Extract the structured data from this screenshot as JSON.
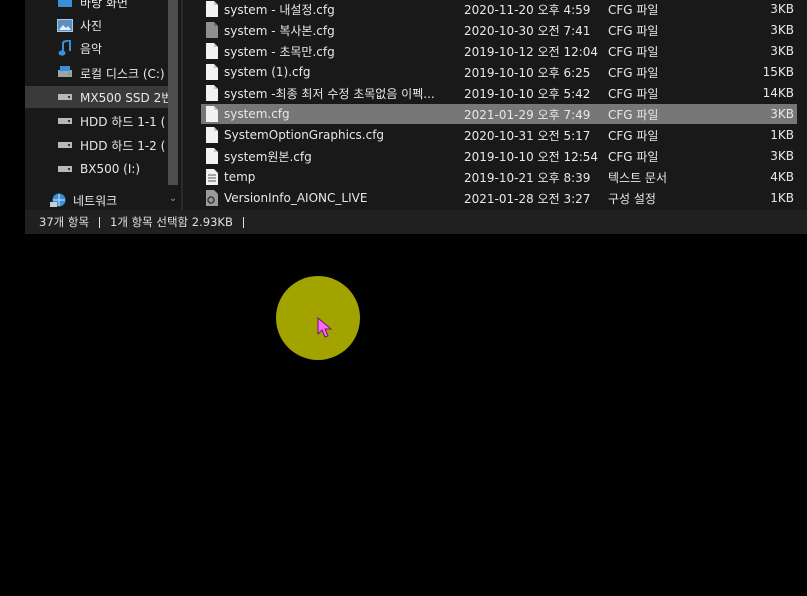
{
  "nav": {
    "items": [
      {
        "label": "바탕 화면",
        "icon": "desktop-icon"
      },
      {
        "label": "사진",
        "icon": "pictures-icon"
      },
      {
        "label": "음악",
        "icon": "music-icon"
      },
      {
        "label": "로컬 디스크 (C:)",
        "icon": "local-disk-icon"
      },
      {
        "label": "MX500 SSD 2번",
        "icon": "drive-icon",
        "selected": true
      },
      {
        "label": "HDD 하드 1-1 (",
        "icon": "drive-icon"
      },
      {
        "label": "HDD 하드 1-2 (",
        "icon": "drive-icon"
      },
      {
        "label": "BX500 (I:)",
        "icon": "drive-icon"
      },
      {
        "label": "네트워크",
        "icon": "network-icon"
      }
    ]
  },
  "files": [
    {
      "name": "system - 내설정.cfg",
      "date": "2020-11-20 오후 4:59",
      "type": "CFG 파일",
      "size": "3KB",
      "icon": "file-icon"
    },
    {
      "name": "system - 복사본.cfg",
      "date": "2020-10-30 오전 7:41",
      "type": "CFG 파일",
      "size": "3KB",
      "icon": "file-gray-icon"
    },
    {
      "name": "system - 초목만.cfg",
      "date": "2019-10-12 오전 12:04",
      "type": "CFG 파일",
      "size": "3KB",
      "icon": "file-icon"
    },
    {
      "name": "system (1).cfg",
      "date": "2019-10-10 오후 6:25",
      "type": "CFG 파일",
      "size": "15KB",
      "icon": "file-icon"
    },
    {
      "name": "system -최종 최저 수정 초목없음 이펙...",
      "date": "2019-10-10 오후 5:42",
      "type": "CFG 파일",
      "size": "14KB",
      "icon": "file-icon"
    },
    {
      "name": "system.cfg",
      "date": "2021-01-29 오후 7:49",
      "type": "CFG 파일",
      "size": "3KB",
      "icon": "file-icon",
      "selected": true
    },
    {
      "name": "SystemOptionGraphics.cfg",
      "date": "2020-10-31 오전 5:17",
      "type": "CFG 파일",
      "size": "1KB",
      "icon": "file-icon"
    },
    {
      "name": "system원본.cfg",
      "date": "2019-10-10 오전 12:54",
      "type": "CFG 파일",
      "size": "3KB",
      "icon": "file-icon"
    },
    {
      "name": "temp",
      "date": "2019-10-21 오후 8:39",
      "type": "텍스트 문서",
      "size": "4KB",
      "icon": "text-file-icon"
    },
    {
      "name": "VersionInfo_AIONC_LIVE",
      "date": "2021-01-28 오전 3:27",
      "type": "구성 설정",
      "size": "1KB",
      "icon": "config-file-icon"
    }
  ],
  "status": {
    "count": "37개 항목",
    "selection": "1개 항목 선택함 2.93KB"
  },
  "colors": {
    "cursor_highlight": "#a3a300",
    "pointer": "#ff66ff",
    "selected_row": "#777777"
  }
}
